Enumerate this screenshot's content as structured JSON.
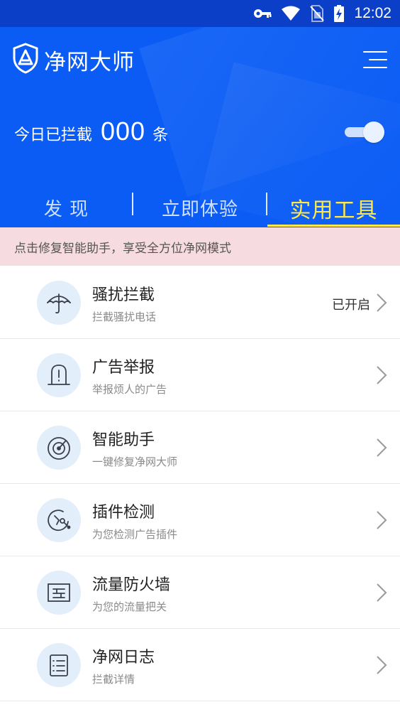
{
  "status_bar": {
    "time": "12:02",
    "icons": [
      "key-icon",
      "wifi-icon",
      "no-sim-icon",
      "battery-charging-icon"
    ]
  },
  "app": {
    "title": "净网大师"
  },
  "blocked": {
    "label": "今日已拦截",
    "count": "000",
    "unit": "条",
    "toggle_on": true
  },
  "tabs": [
    {
      "label": "发 现"
    },
    {
      "label": "立即体验"
    },
    {
      "label": "实用工具",
      "active": true
    }
  ],
  "notice": "点击修复智能助手，享受全方位净网模式",
  "items": [
    {
      "title": "骚扰拦截",
      "subtitle": "拦截骚扰电话",
      "status": "已开启",
      "icon": "umbrella-icon"
    },
    {
      "title": "广告举报",
      "subtitle": "举报烦人的广告",
      "status": "",
      "icon": "report-alert-icon"
    },
    {
      "title": "智能助手",
      "subtitle": "一键修复净网大师",
      "status": "",
      "icon": "radar-icon"
    },
    {
      "title": "插件检测",
      "subtitle": "为您检测广告插件",
      "status": "",
      "icon": "plugin-detect-icon"
    },
    {
      "title": "流量防火墙",
      "subtitle": "为您的流量把关",
      "status": "",
      "icon": "firewall-icon"
    },
    {
      "title": "净网日志",
      "subtitle": "拦截详情",
      "status": "",
      "icon": "log-list-icon"
    }
  ],
  "colors": {
    "status_bar": "#0b3fc7",
    "header": "#0a5cf5",
    "active_tab": "#ffe94a",
    "notice_bg": "#f6dbe0",
    "icon_bg": "#e3eefb"
  }
}
